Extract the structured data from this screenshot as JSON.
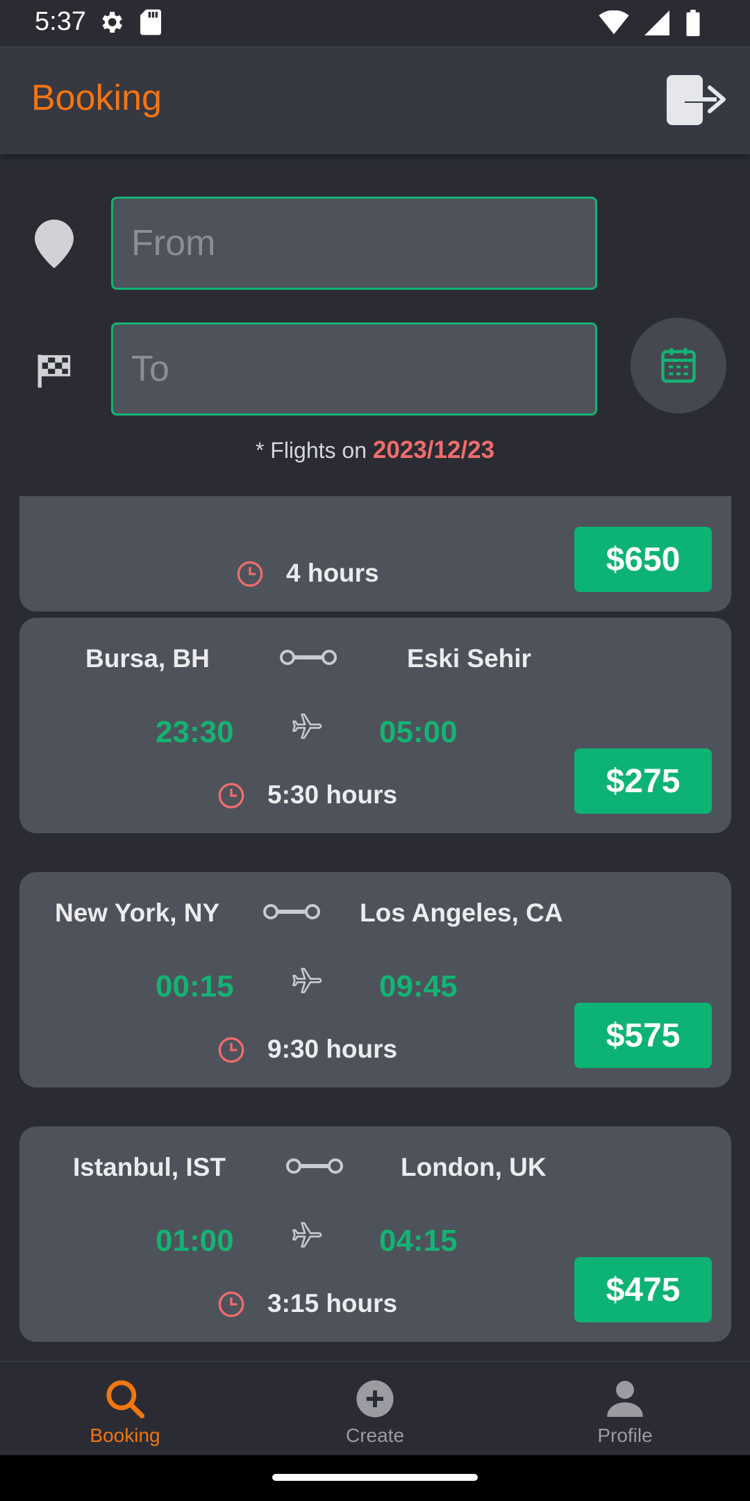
{
  "status_bar": {
    "time": "5:37"
  },
  "app_bar": {
    "title": "Booking"
  },
  "search": {
    "from_placeholder": "From",
    "to_placeholder": "To",
    "flights_on_prefix": "* Flights on ",
    "flights_on_date": "2023/12/23"
  },
  "flights": [
    {
      "duration": "4 hours",
      "price": "$650"
    },
    {
      "from": "Bursa, BH",
      "to": "Eski Sehir",
      "depart": "23:30",
      "arrive": "05:00",
      "duration": "5:30 hours",
      "price": "$275"
    },
    {
      "from": "New York, NY",
      "to": "Los Angeles, CA",
      "depart": "00:15",
      "arrive": "09:45",
      "duration": "9:30 hours",
      "price": "$575"
    },
    {
      "from": "Istanbul, IST",
      "to": "London, UK",
      "depart": "01:00",
      "arrive": "04:15",
      "duration": "3:15 hours",
      "price": "$475"
    }
  ],
  "bottom_nav": {
    "items": [
      {
        "label": "Booking",
        "icon": "search-icon"
      },
      {
        "label": "Create",
        "icon": "add-circle-icon"
      },
      {
        "label": "Profile",
        "icon": "person-icon"
      }
    ]
  },
  "colors": {
    "accent": "#f5750f",
    "green": "#14b374",
    "date": "#ef6d6d",
    "card": "#4e525b",
    "background": "#2b2c33"
  }
}
